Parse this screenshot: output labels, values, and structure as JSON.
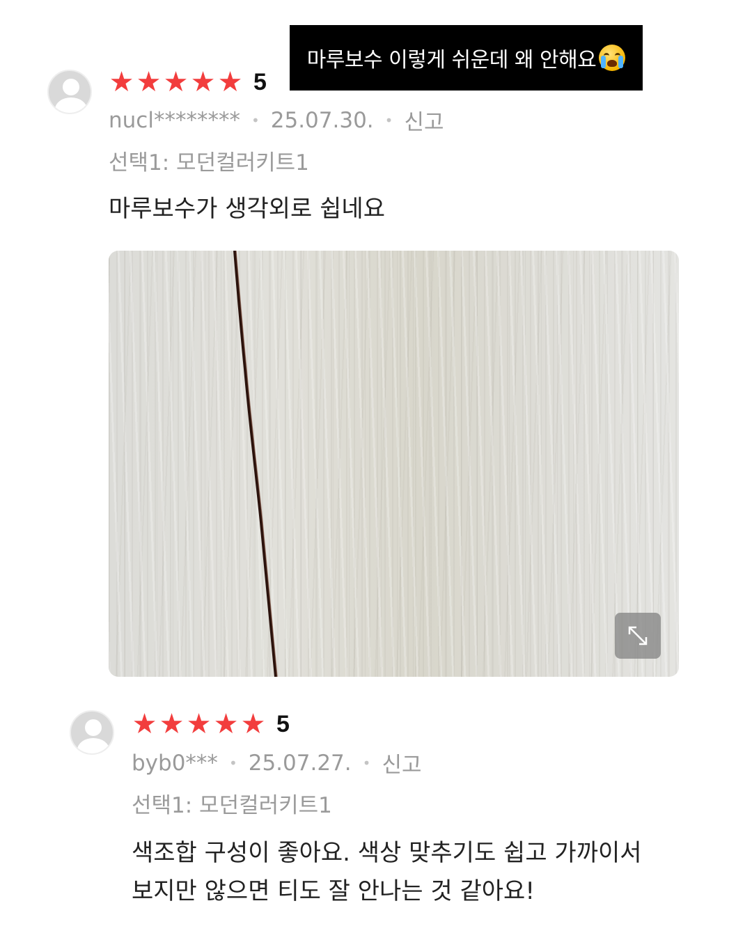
{
  "banner": {
    "caption": "마루보수 이렇게 쉬운데 왜 안해요"
  },
  "reviews": [
    {
      "score": "5",
      "rating_stars": 5,
      "user": "nucl********",
      "date": "25.07.30.",
      "report": "신고",
      "option": "선택1: 모던컬러키트1",
      "text": "마루보수가 생각외로 쉽네요",
      "has_photo": true
    },
    {
      "score": "5",
      "rating_stars": 5,
      "user": "byb0***",
      "date": "25.07.27.",
      "report": "신고",
      "option": "선택1: 모던컬러키트1",
      "text_line1": "색조합 구성이 좋아요. 색상 맞추기도 쉽고 가까이서",
      "text_line2": "보지만 않으면 티도 잘 안나는 것 같아요!"
    }
  ],
  "icons": {
    "star": "star-icon",
    "expand": "expand-icon",
    "avatar": "default-avatar-icon",
    "emoji": "crying-face-emoji"
  },
  "colors": {
    "star": "#f23d3d",
    "meta": "#9a9a9a",
    "banner_bg": "#000000"
  }
}
